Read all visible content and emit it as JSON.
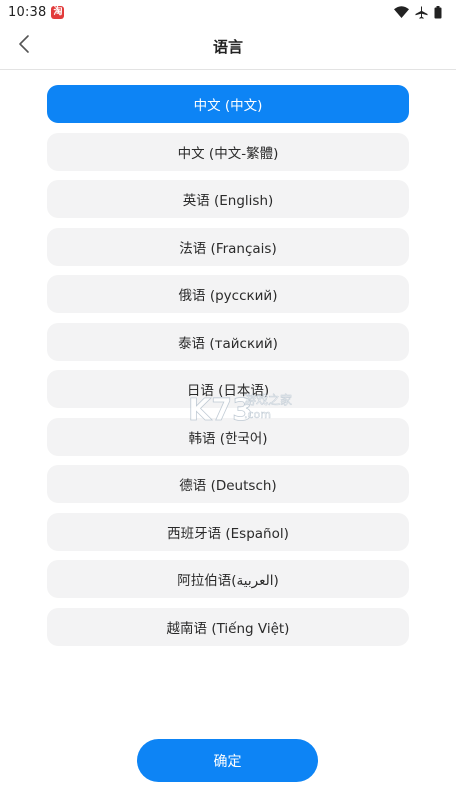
{
  "status_bar": {
    "time": "10:38",
    "badge_text": "淘",
    "icons": [
      "wifi-icon",
      "airplane-icon",
      "battery-icon"
    ]
  },
  "header": {
    "title": "语言",
    "back_icon": "chevron-left-icon"
  },
  "languages": {
    "selected_index": 0,
    "items": [
      {
        "label": "中文 (中文)"
      },
      {
        "label": "中文 (中文-繁體)"
      },
      {
        "label": "英语 (English)"
      },
      {
        "label": "法语 (Français)"
      },
      {
        "label": "俄语 (русский)"
      },
      {
        "label": "泰语 (тайский)"
      },
      {
        "label": "日语 (日本语)"
      },
      {
        "label": "韩语 (한국어)"
      },
      {
        "label": "德语 (Deutsch)"
      },
      {
        "label": "西班牙语 (Español)"
      },
      {
        "label": "阿拉伯语(العربية)"
      },
      {
        "label": "越南语 (Tiếng Việt)"
      }
    ]
  },
  "watermark": {
    "brand": "K73",
    "tagline": "游戏之家",
    "domain": ".com"
  },
  "footer": {
    "confirm_label": "确定"
  },
  "colors": {
    "accent": "#0d84f5",
    "item_bg": "#f3f3f4",
    "badge": "#e23b3b"
  }
}
